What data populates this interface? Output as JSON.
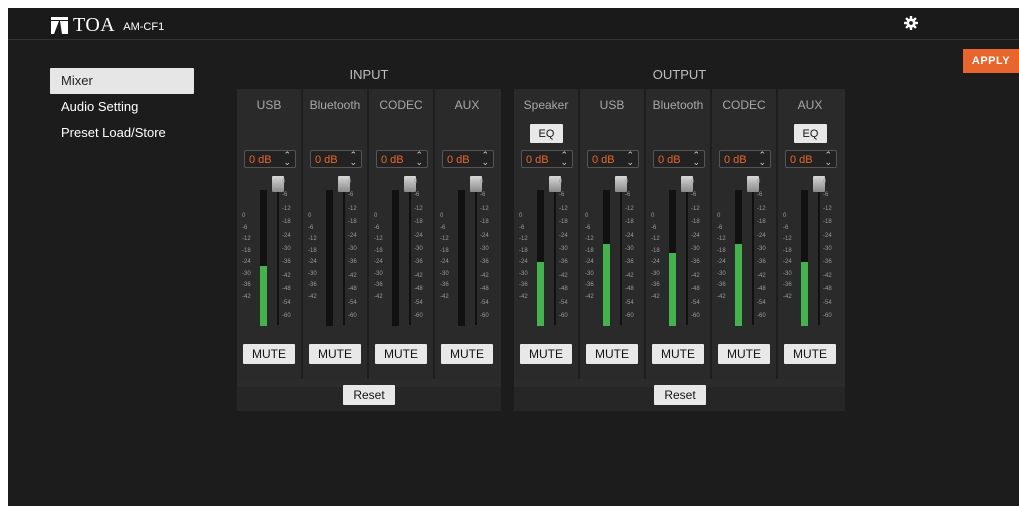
{
  "header": {
    "brand": "TOA",
    "model": "AM-CF1"
  },
  "toolbar": {
    "apply_label": "APPLY"
  },
  "sidebar": {
    "items": [
      {
        "label": "Mixer",
        "active": true
      },
      {
        "label": "Audio Setting",
        "active": false
      },
      {
        "label": "Preset Load/Store",
        "active": false
      }
    ]
  },
  "input": {
    "title": "INPUT",
    "reset_label": "Reset",
    "channels": [
      {
        "name": "USB",
        "gain": "0 dB",
        "mute_label": "MUTE",
        "meter_level": 0.44,
        "fader_db": 0
      },
      {
        "name": "Bluetooth",
        "gain": "0 dB",
        "mute_label": "MUTE",
        "meter_level": 0,
        "fader_db": 0
      },
      {
        "name": "CODEC",
        "gain": "0 dB",
        "mute_label": "MUTE",
        "meter_level": 0,
        "fader_db": 0
      },
      {
        "name": "AUX",
        "gain": "0 dB",
        "mute_label": "MUTE",
        "meter_level": 0,
        "fader_db": 0
      }
    ]
  },
  "output": {
    "title": "OUTPUT",
    "reset_label": "Reset",
    "channels": [
      {
        "name": "Speaker",
        "eq_label": "EQ",
        "gain": "0 dB",
        "mute_label": "MUTE",
        "meter_level": 0.47,
        "fader_db": 0
      },
      {
        "name": "USB",
        "gain": "0 dB",
        "mute_label": "MUTE",
        "meter_level": 0.6,
        "fader_db": 0
      },
      {
        "name": "Bluetooth",
        "gain": "0 dB",
        "mute_label": "MUTE",
        "meter_level": 0.54,
        "fader_db": 0
      },
      {
        "name": "CODEC",
        "gain": "0 dB",
        "mute_label": "MUTE",
        "meter_level": 0.6,
        "fader_db": 0
      },
      {
        "name": "AUX",
        "eq_label": "EQ",
        "gain": "0 dB",
        "mute_label": "MUTE",
        "meter_level": 0.47,
        "fader_db": 0
      }
    ]
  },
  "meter_scale": [
    "0",
    "-6",
    "-12",
    "-18",
    "-24",
    "-30",
    "-36",
    "-42"
  ],
  "fader_scale": [
    "0",
    "-6",
    "-12",
    "-18",
    "-24",
    "-30",
    "-36",
    "-42",
    "-48",
    "-54",
    "-60"
  ],
  "icons": {
    "settings": "gear-icon",
    "logo": "toa-logo-icon",
    "spinner": "up-down-spinner-icon"
  },
  "colors": {
    "accent": "#e8662c",
    "meter": "#44b34d",
    "background": "#1c1c1c",
    "panel": "#2b2b2b"
  }
}
